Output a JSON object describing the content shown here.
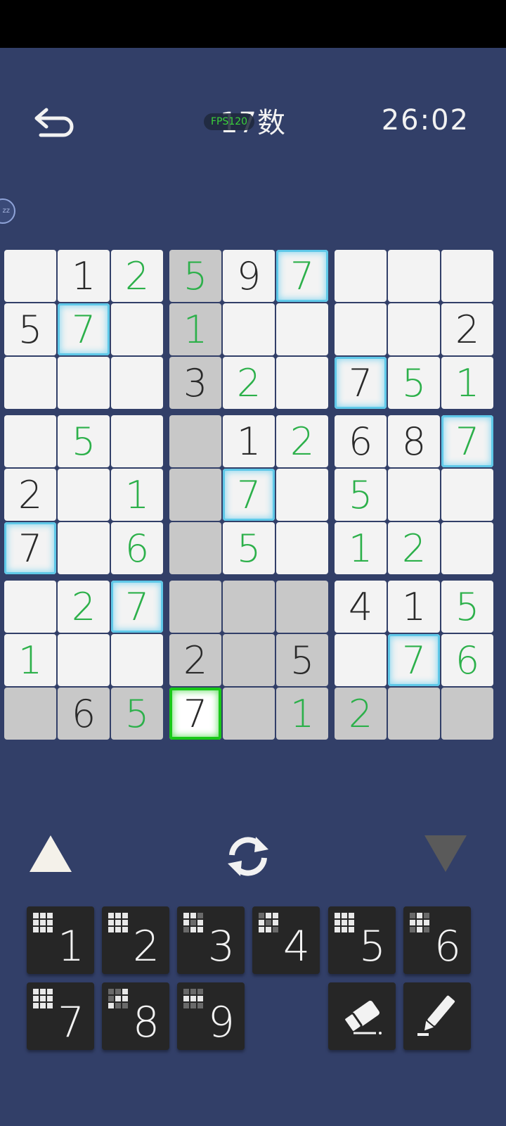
{
  "header": {
    "title": "17数",
    "fps": "FPS120",
    "timer": "26:02",
    "float_label": "zz"
  },
  "board": {
    "cells": [
      [
        "",
        "1",
        "2",
        "5",
        "9",
        "7",
        "",
        "",
        ""
      ],
      [
        "5",
        "7",
        "",
        "1",
        "",
        "",
        "",
        "",
        "2"
      ],
      [
        "",
        "",
        "",
        "3",
        "2",
        "",
        "7",
        "5",
        "1"
      ],
      [
        "",
        "5",
        "",
        "",
        "1",
        "2",
        "6",
        "8",
        "7"
      ],
      [
        "2",
        "",
        "1",
        "",
        "7",
        "",
        "5",
        "",
        ""
      ],
      [
        "7",
        "",
        "6",
        "",
        "5",
        "",
        "1",
        "2",
        ""
      ],
      [
        "",
        "2",
        "7",
        "",
        "",
        "",
        "4",
        "1",
        "5"
      ],
      [
        "1",
        "",
        "",
        "2",
        "",
        "5",
        "",
        "7",
        "6"
      ],
      [
        "",
        "6",
        "5",
        "7",
        "",
        "1",
        "2",
        "",
        ""
      ]
    ],
    "kinds": [
      [
        "",
        "g",
        "u",
        "u",
        "g",
        "u",
        "",
        "",
        ""
      ],
      [
        "g",
        "u",
        "",
        "u",
        "",
        "",
        "",
        "",
        "g"
      ],
      [
        "",
        "",
        "",
        "g",
        "u",
        "",
        "g",
        "u",
        "u"
      ],
      [
        "",
        "u",
        "",
        "",
        "g",
        "u",
        "g",
        "g",
        "u"
      ],
      [
        "g",
        "",
        "u",
        "",
        "u",
        "",
        "u",
        "",
        ""
      ],
      [
        "g",
        "",
        "u",
        "",
        "u",
        "",
        "u",
        "u",
        ""
      ],
      [
        "",
        "u",
        "u",
        "",
        "",
        "",
        "g",
        "g",
        "u"
      ],
      [
        "u",
        "",
        "",
        "g",
        "",
        "g",
        "",
        "u",
        "u"
      ],
      [
        "",
        "g",
        "u",
        "g",
        "",
        "u",
        "u",
        "",
        ""
      ]
    ],
    "shaded": [
      [
        0,
        0,
        0,
        1,
        0,
        0,
        0,
        0,
        0
      ],
      [
        0,
        0,
        0,
        1,
        0,
        0,
        0,
        0,
        0
      ],
      [
        0,
        0,
        0,
        1,
        0,
        0,
        0,
        0,
        0
      ],
      [
        0,
        0,
        0,
        1,
        0,
        0,
        0,
        0,
        0
      ],
      [
        0,
        0,
        0,
        1,
        0,
        0,
        0,
        0,
        0
      ],
      [
        0,
        0,
        0,
        1,
        0,
        0,
        0,
        0,
        0
      ],
      [
        0,
        0,
        0,
        1,
        1,
        1,
        0,
        0,
        0
      ],
      [
        0,
        0,
        0,
        1,
        1,
        1,
        0,
        0,
        0
      ],
      [
        1,
        1,
        1,
        0,
        1,
        1,
        1,
        1,
        1
      ]
    ],
    "highlighted_cells": [
      [
        0,
        5
      ],
      [
        1,
        1
      ],
      [
        2,
        6
      ],
      [
        3,
        8
      ],
      [
        4,
        4
      ],
      [
        5,
        0
      ],
      [
        6,
        2
      ],
      [
        7,
        7
      ]
    ],
    "selected_cell": [
      8,
      3
    ]
  },
  "controls": {
    "up": "triangle-up-icon",
    "refresh": "refresh-icon",
    "down": "triangle-down-icon"
  },
  "keypad": {
    "numbers": [
      {
        "label": "1",
        "dots_dark": [
          false,
          false,
          false,
          false,
          false,
          false,
          false,
          false,
          false
        ]
      },
      {
        "label": "2",
        "dots_dark": [
          false,
          false,
          false,
          false,
          false,
          false,
          false,
          false,
          false
        ]
      },
      {
        "label": "3",
        "dots_dark": [
          false,
          false,
          true,
          false,
          true,
          false,
          true,
          false,
          false
        ]
      },
      {
        "label": "4",
        "dots_dark": [
          true,
          false,
          false,
          false,
          true,
          false,
          false,
          false,
          true
        ]
      },
      {
        "label": "5",
        "dots_dark": [
          false,
          false,
          false,
          false,
          false,
          false,
          false,
          false,
          false
        ]
      },
      {
        "label": "6",
        "dots_dark": [
          true,
          false,
          true,
          false,
          false,
          false,
          true,
          false,
          true
        ]
      },
      {
        "label": "7",
        "dots_dark": [
          false,
          false,
          false,
          false,
          false,
          false,
          false,
          false,
          false
        ]
      },
      {
        "label": "8",
        "dots_dark": [
          true,
          true,
          false,
          true,
          false,
          false,
          false,
          true,
          true
        ]
      },
      {
        "label": "9",
        "dots_dark": [
          true,
          true,
          true,
          false,
          false,
          false,
          true,
          true,
          true
        ]
      }
    ],
    "tools": [
      "eraser-icon",
      "pencil-icon"
    ]
  },
  "colors": {
    "background": "#323f68",
    "given_digit": "#2a2a2a",
    "user_digit": "#2cb04a",
    "highlight": "#5fc8e8",
    "selected": "#18c818"
  }
}
